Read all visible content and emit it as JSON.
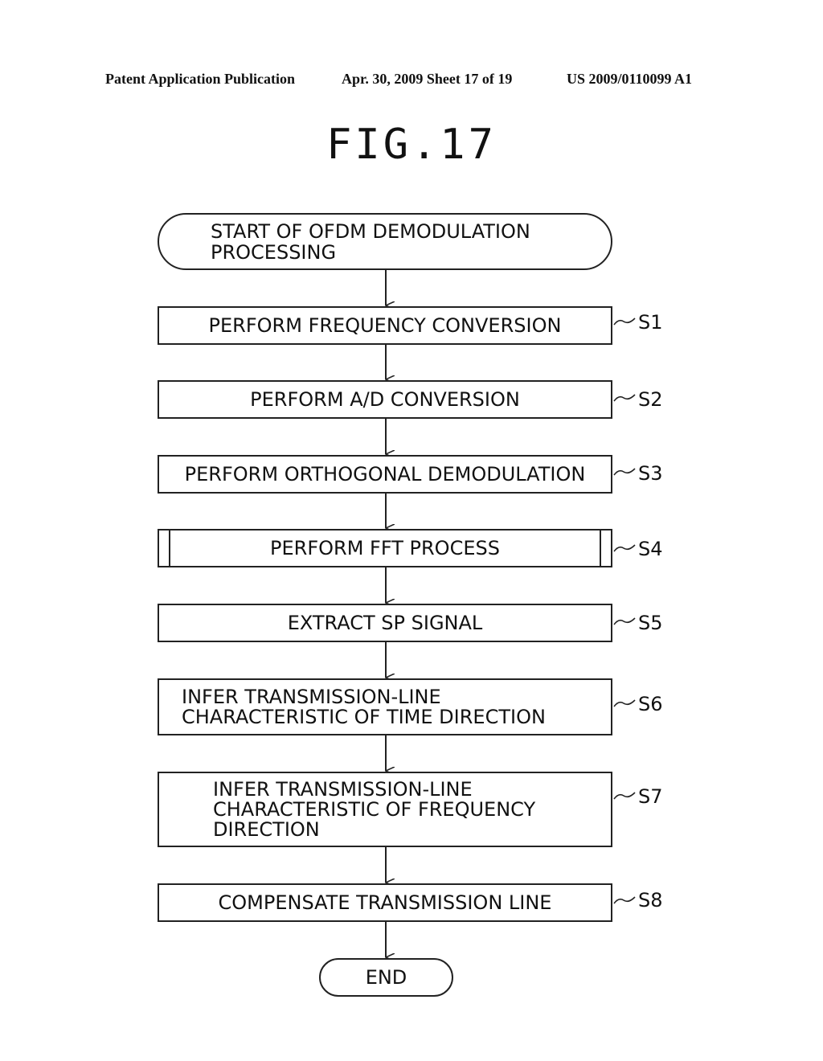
{
  "header": {
    "publication": "Patent Application Publication",
    "date_sheet": "Apr. 30, 2009  Sheet 17 of 19",
    "number": "US 2009/0110099 A1"
  },
  "figure": {
    "title": "FIG.17"
  },
  "flowchart": {
    "start": {
      "line1": "START OF OFDM DEMODULATION",
      "line2": "PROCESSING"
    },
    "steps": [
      {
        "id": "S1",
        "lines": [
          "PERFORM FREQUENCY CONVERSION"
        ]
      },
      {
        "id": "S2",
        "lines": [
          "PERFORM A/D CONVERSION"
        ]
      },
      {
        "id": "S3",
        "lines": [
          "PERFORM ORTHOGONAL DEMODULATION"
        ]
      },
      {
        "id": "S4",
        "lines": [
          "PERFORM FFT PROCESS"
        ],
        "predefined_process": true
      },
      {
        "id": "S5",
        "lines": [
          "EXTRACT SP SIGNAL"
        ]
      },
      {
        "id": "S6",
        "lines": [
          "INFER TRANSMISSION-LINE",
          "CHARACTERISTIC OF TIME DIRECTION"
        ]
      },
      {
        "id": "S7",
        "lines": [
          "INFER TRANSMISSION-LINE",
          "CHARACTERISTIC OF FREQUENCY",
          "DIRECTION"
        ]
      },
      {
        "id": "S8",
        "lines": [
          "COMPENSATE TRANSMISSION LINE"
        ]
      }
    ],
    "end": {
      "label": "END"
    }
  }
}
